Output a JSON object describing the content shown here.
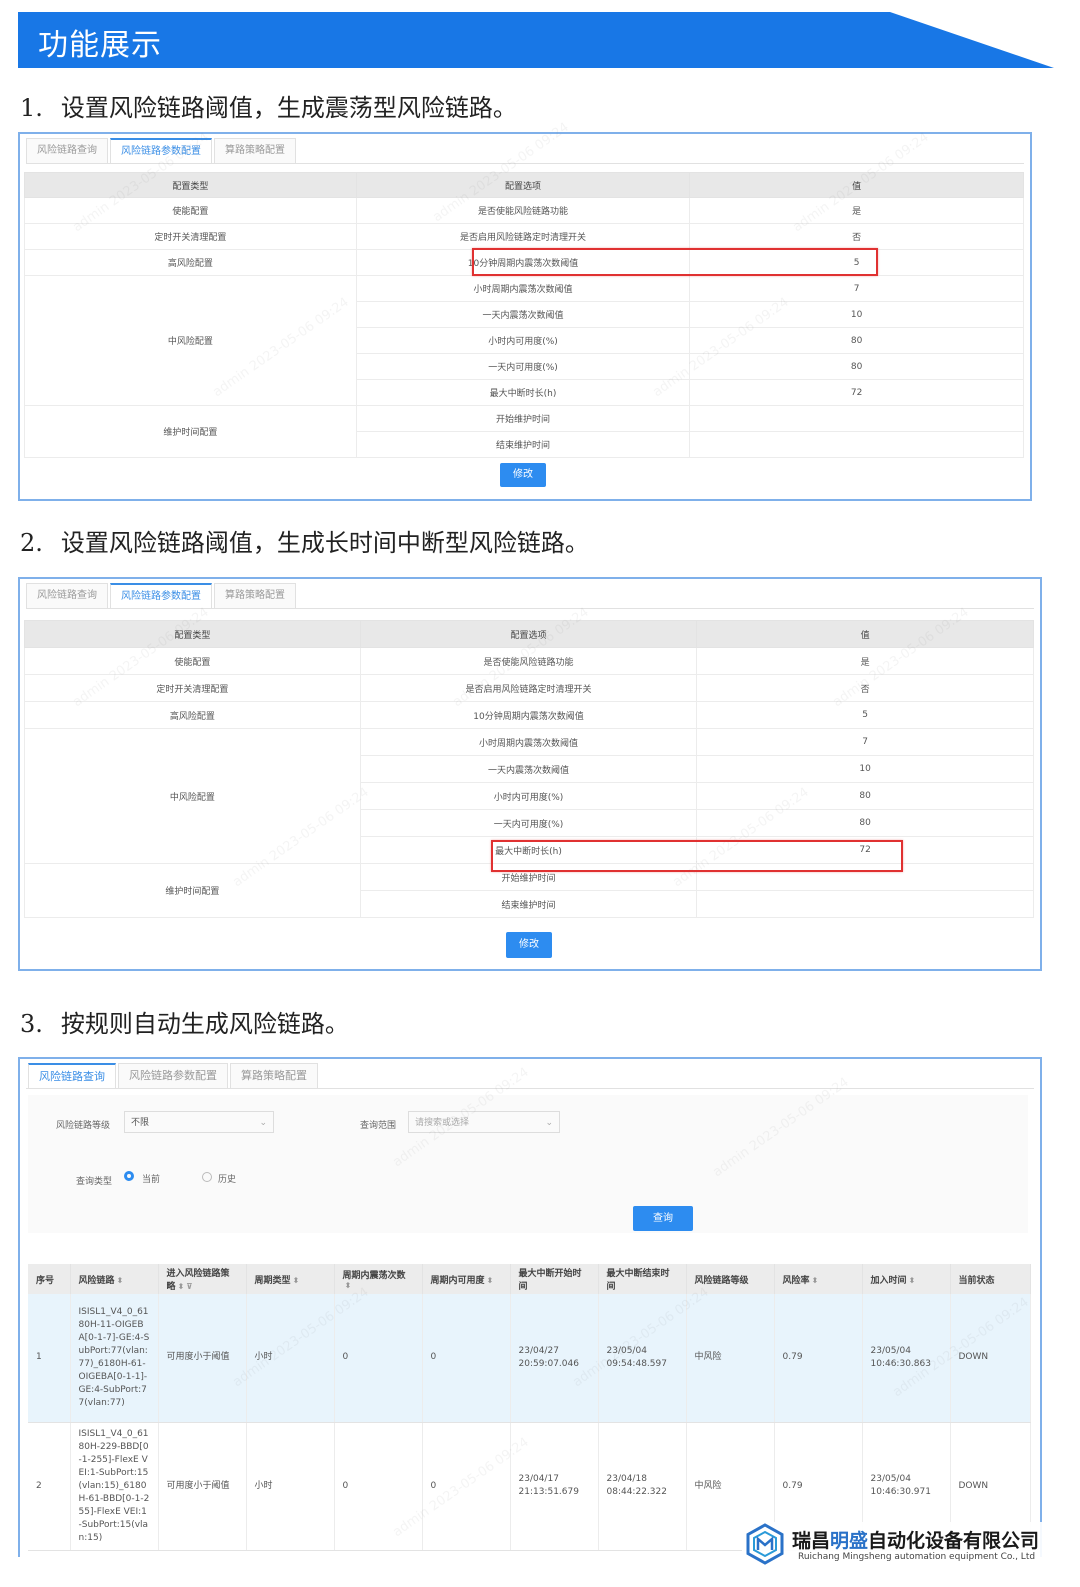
{
  "banner": {
    "title": "功能展示"
  },
  "sections": [
    {
      "num": "1.",
      "text": "设置风险链路阈值，生成震荡型风险链路。"
    },
    {
      "num": "2.",
      "text": "设置风险链路阈值，生成长时间中断型风险链路。"
    },
    {
      "num": "3.",
      "text": "按规则自动生成风险链路。"
    }
  ],
  "tabs": [
    "风险链路查询",
    "风险链路参数配置",
    "算路策略配置"
  ],
  "config_table": {
    "headers": [
      "配置类型",
      "配置选项",
      "值"
    ],
    "rows": [
      {
        "type": "使能配置",
        "option": "是否使能风险链路功能",
        "value": "是"
      },
      {
        "type": "定时开关清理配置",
        "option": "是否启用风险链路定时清理开关",
        "value": "否"
      },
      {
        "type": "高风险配置",
        "option": "10分钟周期内震荡次数阈值",
        "value": "5"
      },
      {
        "type": "中风险配置",
        "option": "小时周期内震荡次数阈值",
        "value": "7"
      },
      {
        "type": "",
        "option": "一天内震荡次数阈值",
        "value": "10"
      },
      {
        "type": "",
        "option": "小时内可用度(%)",
        "value": "80"
      },
      {
        "type": "",
        "option": "一天内可用度(%)",
        "value": "80"
      },
      {
        "type": "",
        "option": "最大中断时长(h)",
        "value": "72"
      },
      {
        "type": "维护时间配置",
        "option": "开始维护时间",
        "value": ""
      },
      {
        "type": "",
        "option": "结束维护时间",
        "value": ""
      }
    ],
    "button": "修改"
  },
  "query_form": {
    "level_label": "风险链路等级",
    "level_value": "不限",
    "range_label": "查询范围",
    "range_placeholder": "请搜索或选择",
    "type_label": "查询类型",
    "radio_current": "当前",
    "radio_history": "历史",
    "search_button": "查询"
  },
  "results_table": {
    "headers": [
      "序号",
      "风险链路",
      "进入风险链路策略",
      "周期类型",
      "周期内震荡次数",
      "周期内可用度",
      "最大中断开始时间",
      "最大中断结束时间",
      "风险链路等级",
      "风险率",
      "加入时间",
      "当前状态"
    ],
    "rows": [
      {
        "idx": "1",
        "link": "ISISL1_V4_0_6180H-11-OIGEBA[0-1-7]-GE:4-SubPort:77(vlan:77)_6180H-61-OIGEBA[0-1-1]-GE:4-SubPort:77(vlan:77)",
        "policy": "可用度小于阈值",
        "period": "小时",
        "flaps": "0",
        "avail": "0",
        "start": "23/04/27 20:59:07.046",
        "end": "23/05/04 09:54:48.597",
        "level": "中风险",
        "rate": "0.79",
        "joined": "23/05/04 10:46:30.863",
        "state": "DOWN"
      },
      {
        "idx": "2",
        "link": "ISISL1_V4_0_6180H-229-BBD[0-1-255]-FlexE VEI:1-SubPort:15(vlan:15)_6180H-61-BBD[0-1-255]-FlexE VEI:1-SubPort:15(vlan:15)",
        "policy": "可用度小于阈值",
        "period": "小时",
        "flaps": "0",
        "avail": "0",
        "start": "23/04/17 21:13:51.679",
        "end": "23/04/18 08:44:22.322",
        "level": "中风险",
        "rate": "0.79",
        "joined": "23/05/04 10:46:30.971",
        "state": "DOWN"
      }
    ]
  },
  "watermark": "admin 2023-05-06 09:24",
  "company": {
    "name_pre": "瑞昌",
    "name_hi": "明盛",
    "name_post": "自动化设备有限公司",
    "english": "Ruichang Mingsheng automation equipment Co., Ltd"
  }
}
